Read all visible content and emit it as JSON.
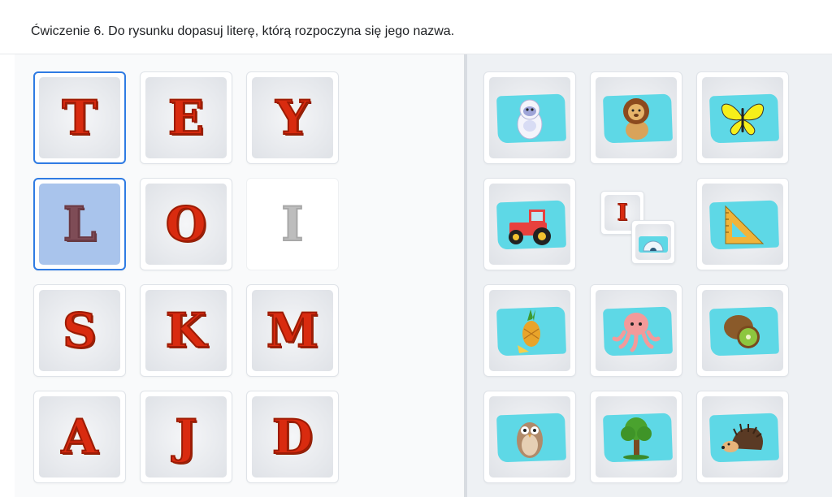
{
  "header": {
    "instruction": "Ćwiczenie 6. Do rysunku dopasuj literę, którą rozpoczyna się jego nazwa."
  },
  "letters": [
    {
      "letter": "T",
      "state": "focused"
    },
    {
      "letter": "E",
      "state": "normal"
    },
    {
      "letter": "Y",
      "state": "normal"
    },
    {
      "letter": "L",
      "state": "selected"
    },
    {
      "letter": "O",
      "state": "normal"
    },
    {
      "letter": "I",
      "state": "used"
    },
    {
      "letter": "S",
      "state": "normal"
    },
    {
      "letter": "K",
      "state": "normal"
    },
    {
      "letter": "M",
      "state": "normal"
    },
    {
      "letter": "A",
      "state": "normal"
    },
    {
      "letter": "J",
      "state": "normal"
    },
    {
      "letter": "D",
      "state": "normal"
    }
  ],
  "pictures": [
    {
      "icon": "yeti-icon"
    },
    {
      "icon": "lion-icon"
    },
    {
      "icon": "butterfly-icon"
    },
    {
      "icon": "tractor-icon"
    },
    {
      "icon": "matched-pair",
      "matched_letter": "I",
      "matched_icon": "igloo-icon"
    },
    {
      "icon": "set-square-icon"
    },
    {
      "icon": "pineapple-icon"
    },
    {
      "icon": "octopus-icon"
    },
    {
      "icon": "kiwi-icon"
    },
    {
      "icon": "owl-icon"
    },
    {
      "icon": "tree-icon"
    },
    {
      "icon": "hedgehog-icon"
    }
  ],
  "colors": {
    "letter_red": "#d92b0f",
    "selected_tile": "#a9c4ec",
    "focus_border": "#2f7be3",
    "picture_blob": "#5ed8e6"
  }
}
